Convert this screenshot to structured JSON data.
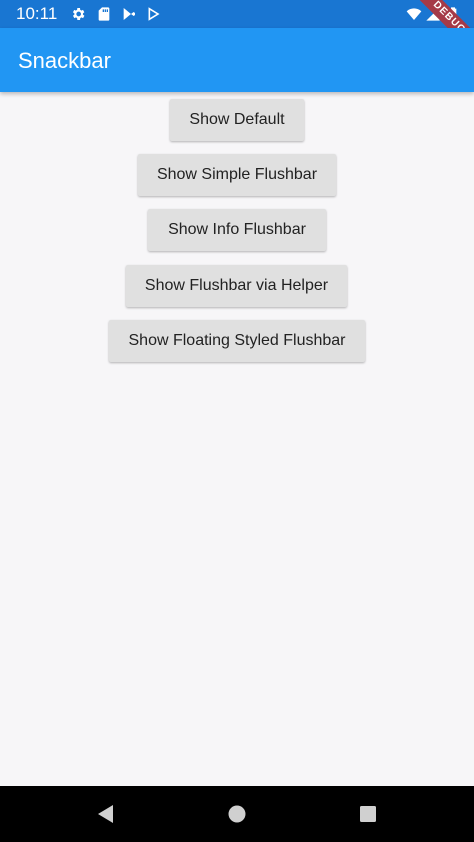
{
  "status_bar": {
    "time": "10:11",
    "icons": [
      "gear-icon",
      "sd-card-icon",
      "play-store-icon",
      "play-store-outline-icon",
      "wifi-icon",
      "signal-icon",
      "battery-icon"
    ],
    "debug_label": "DEBUG",
    "color": "#1976d2"
  },
  "app_bar": {
    "title": "Snackbar",
    "color": "#2196f3"
  },
  "buttons": [
    {
      "label": "Show Default"
    },
    {
      "label": "Show Simple Flushbar"
    },
    {
      "label": "Show Info Flushbar"
    },
    {
      "label": "Show Flushbar via Helper"
    },
    {
      "label": "Show Floating Styled Flushbar"
    }
  ],
  "nav_bar": {
    "icons": [
      "back-icon",
      "home-icon",
      "recents-icon"
    ]
  }
}
